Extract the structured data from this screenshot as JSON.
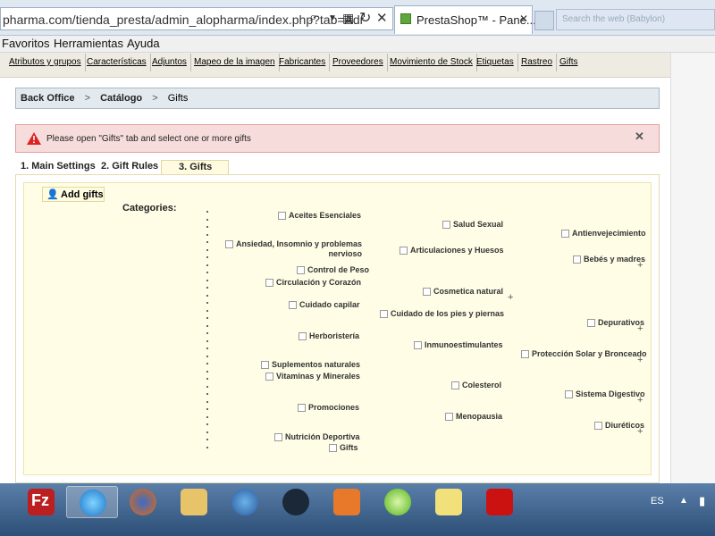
{
  "browser": {
    "url": "pharma.com/tienda_presta/admin_alopharma/index.php?tab=Adr",
    "tab_title": "PrestaShop™ - Pane...",
    "search_placeholder": "Search the web (Babylon)",
    "menu": [
      "Favoritos",
      "Herramientas",
      "Ayuda"
    ]
  },
  "subtabs": [
    "Atributos y grupos",
    "Características",
    "Adjuntos",
    "Mapeo de la imagen",
    "Fabricantes",
    "Proveedores",
    "Movimiento de Stock",
    "Etiquetas",
    "Rastreo",
    "Gifts"
  ],
  "breadcrumb": {
    "items": [
      "Back Office",
      "Catálogo",
      "Gifts"
    ],
    "separator": ">"
  },
  "error": {
    "message": "Please open \"Gifts\" tab and select one or more gifts",
    "close": "✕"
  },
  "tabs": [
    "1. Main Settings",
    "2. Gift Rules",
    "3. Gifts"
  ],
  "panel": {
    "add_gifts": "Add gifts",
    "categories_label": "Categories:",
    "categories": [
      "Aceites Esenciales",
      "Salud Sexual",
      "Antienvejecimiento",
      "Ansiedad, Insomnio y problemas",
      "nervioso",
      "Articulaciones y Huesos",
      "Bebés y madres",
      "Control de Peso",
      "Circulación y Corazón",
      "Cosmetica natural",
      "Cuidado capilar",
      "Cuidado de los pies y piernas",
      "Depurativos",
      "Herboristería",
      "Inmunoestimulantes",
      "Protección Solar y Bronceado",
      "Suplementos naturales",
      "Vitaminas y Minerales",
      "Colesterol",
      "Sistema Digestivo",
      "Promociones",
      "Menopausia",
      "Diuréticos",
      "Nutrición Deportiva",
      "Gifts"
    ],
    "plus": "+"
  },
  "taskbar": {
    "lang": "ES"
  }
}
